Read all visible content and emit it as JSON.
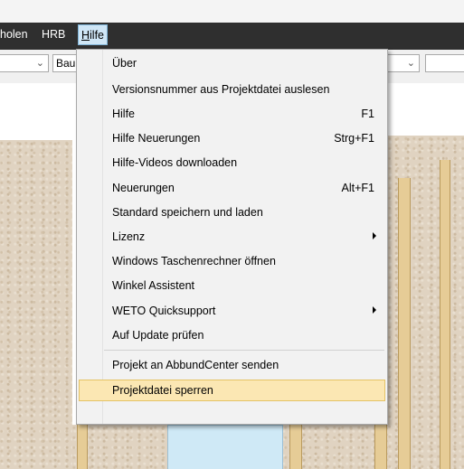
{
  "menubar": {
    "items": [
      {
        "label": "holen"
      },
      {
        "label": "HRB"
      },
      {
        "label_prefix": "H",
        "label_rest": "ilfe"
      }
    ]
  },
  "toolbar": {
    "combo2_text": "Bau"
  },
  "dropdown": {
    "items": [
      {
        "label": "Über",
        "shortcut": ""
      },
      {
        "label": "Versionsnummer aus Projektdatei auslesen",
        "shortcut": ""
      },
      {
        "label": "Hilfe",
        "shortcut": "F1"
      },
      {
        "label": "Hilfe Neuerungen",
        "shortcut": "Strg+F1"
      },
      {
        "label": "Hilfe-Videos downloaden",
        "shortcut": ""
      },
      {
        "label": "Neuerungen",
        "shortcut": "Alt+F1"
      },
      {
        "label": "Standard speichern und laden",
        "shortcut": ""
      },
      {
        "label": "Lizenz",
        "shortcut": "",
        "submenu": true
      },
      {
        "label": "Windows Taschenrechner öffnen",
        "shortcut": ""
      },
      {
        "label": "Winkel Assistent",
        "shortcut": ""
      },
      {
        "label": "WETO Quicksupport",
        "shortcut": "",
        "submenu": true
      },
      {
        "label": "Auf Update prüfen",
        "shortcut": ""
      },
      {
        "label": "Projekt an AbbundCenter senden",
        "shortcut": ""
      },
      {
        "label": "Projektdatei sperren",
        "shortcut": "",
        "highlighted": true
      }
    ]
  },
  "colors": {
    "menubar_bg": "#2f2f2f",
    "highlight_bg": "#fbe7b3",
    "highlight_border": "#e5c365"
  }
}
